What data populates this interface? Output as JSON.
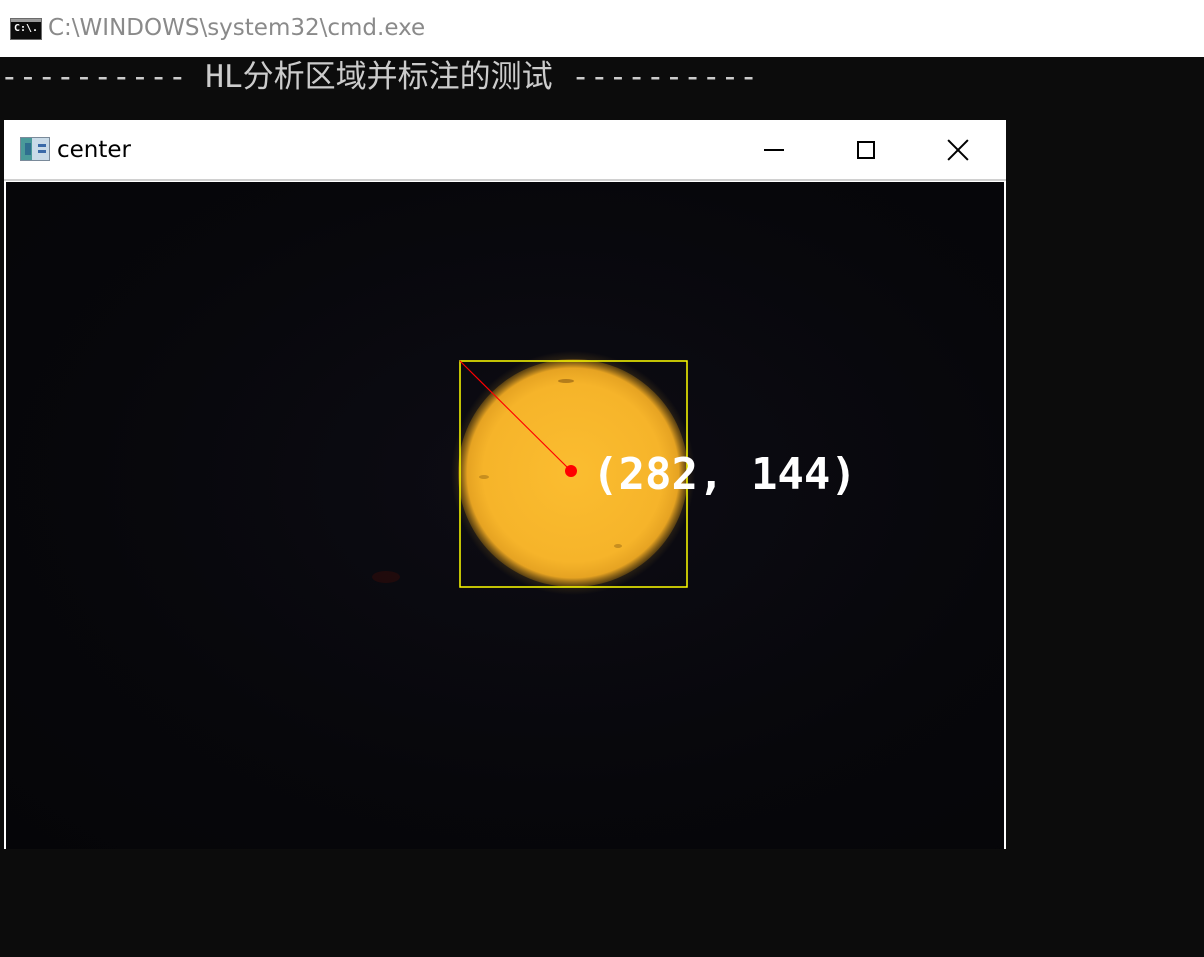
{
  "console": {
    "title": "C:\\WINDOWS\\system32\\cmd.exe",
    "icon": "console-icon",
    "icon_text": "C:\\.",
    "output_line": "---------- HL分析区域并标注的测试 ----------"
  },
  "image_window": {
    "title": "center",
    "icon": "opencv-window-icon",
    "controls": {
      "minimize": "minimize-icon",
      "maximize": "maximize-icon",
      "close": "close-icon"
    }
  },
  "annotation": {
    "center_label": "(282, 144)",
    "box_color": "#ffff00",
    "line_color": "#ff0000",
    "point_color": "#ff0000",
    "label_color": "#ffffff",
    "object_color": "#f5b62a"
  }
}
